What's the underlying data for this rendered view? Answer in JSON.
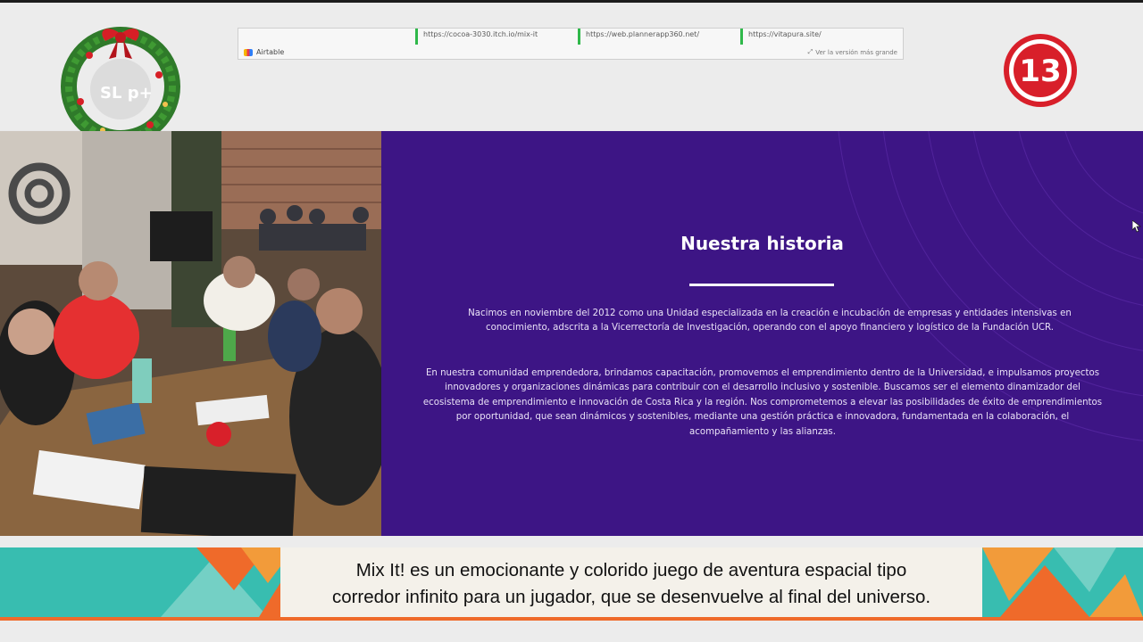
{
  "browser": {
    "url_cards": [
      "https://cocoa-3030.itch.io/mix-it",
      "https://web.plannerapp360.net/",
      "https://vitapura.site/"
    ],
    "airtable_label": "Airtable",
    "enlarge_label": "Ver la versión más grande"
  },
  "logos": {
    "show_logo": "SL p+",
    "channel_number": "13"
  },
  "story": {
    "title": "Nuestra historia",
    "paragraph1": "Nacimos en noviembre del 2012 como una Unidad especializada en la creación e incubación de empresas y entidades intensivas en conocimiento, adscrita a la Vicerrectoría de Investigación, operando con el apoyo financiero y logístico de la Fundación UCR.",
    "paragraph2": "En nuestra comunidad emprendedora, brindamos capacitación, promovemos el emprendimiento dentro de la Universidad, e impulsamos proyectos innovadores y organizaciones dinámicas para contribuir con el desarrollo inclusivo y sostenible. Buscamos ser el elemento dinamizador del ecosistema de emprendimiento e innovación de Costa Rica y la región. Nos comprometemos a elevar las posibilidades de éxito de emprendimientos por oportunidad, que sean dinámicos y sostenibles, mediante una gestión práctica e innovadora, fundamentada en la colaboración, el acompañamiento y las alianzas."
  },
  "caption": {
    "line1": "Mix It! es un emocionante y colorido juego de aventura espacial tipo",
    "line2": "corredor infinito para un jugador, que se desenvuelve al final del universo."
  },
  "colors": {
    "story_bg": "#3d1585",
    "caption_bg": "#38bdb0",
    "caption_accent": "#ef6a2a",
    "channel_red": "#d81f2a"
  }
}
